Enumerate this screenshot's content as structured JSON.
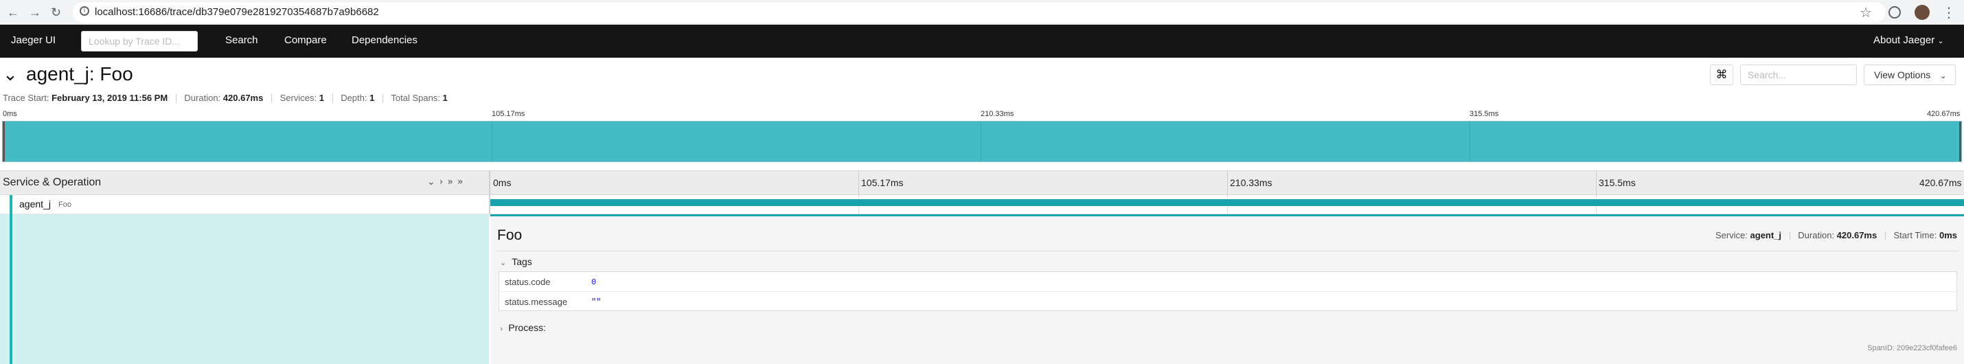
{
  "browser": {
    "url": "localhost:16686/trace/db379e079e2819270354687b7a9b6682",
    "back_icon": "arrow-left-icon",
    "forward_icon": "arrow-right-icon",
    "reload_icon": "reload-icon"
  },
  "topnav": {
    "brand": "Jaeger UI",
    "lookup_placeholder": "Lookup by Trace ID...",
    "links": [
      "Search",
      "Compare",
      "Dependencies"
    ],
    "about": "About Jaeger"
  },
  "trace": {
    "title": "agent_j: Foo",
    "search_placeholder": "Search...",
    "view_options": "View Options",
    "meta": {
      "start_label": "Trace Start:",
      "start_value": "February 13, 2019 11:56 PM",
      "duration_label": "Duration:",
      "duration_value": "420.67ms",
      "services_label": "Services:",
      "services_value": "1",
      "depth_label": "Depth:",
      "depth_value": "1",
      "spans_label": "Total Spans:",
      "spans_value": "1"
    },
    "minimap_ticks": [
      "0ms",
      "105.17ms",
      "210.33ms",
      "315.5ms",
      "420.67ms"
    ]
  },
  "timeline": {
    "header_label": "Service & Operation",
    "ticks": [
      "0ms",
      "105.17ms",
      "210.33ms",
      "315.5ms",
      "420.67ms"
    ]
  },
  "span": {
    "service": "agent_j",
    "operation": "Foo",
    "name": "Foo",
    "service_label": "Service:",
    "service_value": "agent_j",
    "duration_label": "Duration:",
    "duration_value": "420.67ms",
    "start_label": "Start Time:",
    "start_value": "0ms",
    "tags_label": "Tags",
    "tags": [
      {
        "key": "status.code",
        "value": "0"
      },
      {
        "key": "status.message",
        "value": "\"\""
      }
    ],
    "process_label": "Process:",
    "span_id": "SpanID: 209e223cf0fafee6"
  },
  "colors": {
    "span": "#17a2ac",
    "minimap": "#43bcc4",
    "nav": "#151515"
  }
}
